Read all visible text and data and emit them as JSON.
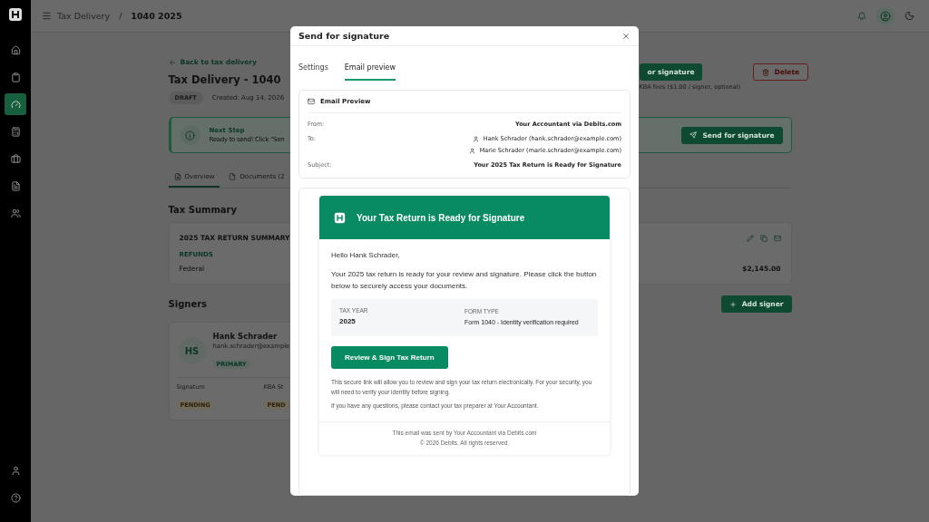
{
  "sidebar": {
    "nav": [
      {
        "selected": false
      },
      {
        "selected": false
      },
      {
        "selected": true
      },
      {
        "selected": false
      },
      {
        "selected": false
      },
      {
        "selected": false
      },
      {
        "selected": false
      }
    ]
  },
  "topbar": {
    "separator": "/",
    "breadcrumb": [
      {
        "label": "Tax Delivery",
        "current": false
      },
      {
        "label": "1040 2025",
        "current": true
      }
    ]
  },
  "page": {
    "back_link": "Back to tax delivery",
    "title": "Tax Delivery - 1040",
    "status": "DRAFT",
    "created": "Created: Aug 14, 2026",
    "actions": {
      "send_button": "or signature",
      "delete_button": "Delete",
      "note": "KBA fees ($1.00 / signer, optional)"
    },
    "next_step": {
      "title": "Next Step",
      "text": "Ready to send! Click \"Sen",
      "button": "Send for signature"
    },
    "tabs": [
      {
        "label": "Overview",
        "selected": true
      },
      {
        "label": "Documents (2",
        "selected": false
      }
    ],
    "tax_summary": {
      "heading": "Tax Summary",
      "card_title": "2025 TAX RETURN SUMMARY",
      "section": "REFUNDS",
      "rows": [
        {
          "label": "Federal",
          "amount": "$2,145.00"
        }
      ]
    },
    "signers": {
      "heading": "Signers",
      "add_button": "Add signer",
      "list": [
        {
          "initials": "HS",
          "name": "Hank Schrader",
          "email": "hank.schrader@example",
          "role": "PRIMARY",
          "signature_label": "Signature",
          "signature_status": "PENDING",
          "kba_label": "KBA St",
          "kba_status": "PEND"
        }
      ]
    }
  },
  "modal": {
    "title": "Send for signature",
    "tabs": [
      {
        "label": "Settings",
        "selected": false
      },
      {
        "label": "Email preview",
        "selected": true
      }
    ],
    "preview": {
      "heading": "Email Preview",
      "fields": [
        {
          "label": "From:",
          "kind": "text",
          "values": [
            "Your Accountant via Debits.com"
          ]
        },
        {
          "label": "To:",
          "kind": "recipients",
          "values": [
            "Hank Schrader (hank.schrader@example.com)",
            "Marie Schrader (marie.schrader@example.com)"
          ]
        },
        {
          "label": "Subject:",
          "kind": "text",
          "values": [
            "Your 2025 Tax Return is Ready for Signature"
          ]
        }
      ]
    },
    "email": {
      "header": "Your Tax Return is Ready for Signature",
      "greeting": "Hello Hank Schrader,",
      "intro": "Your 2025 tax return is ready for your review and signature. Please click the button below to securely access your documents.",
      "details": [
        {
          "label": "TAX YEAR",
          "value": "2025",
          "kind": "strong"
        },
        {
          "label": "FORM TYPE",
          "value": "Form 1040 - Identity verification required",
          "kind": "plain"
        }
      ],
      "button": "Review & Sign Tax Return",
      "notes": [
        "This secure link will allow you to review and sign your tax return electronically. For your security, you will need to verify your identity before signing.",
        "If you have any questions, please contact your tax preparer at Your Accountant."
      ],
      "footer": [
        "This email was sent by Your Accountant via Debits.com",
        "© 2026 Debits. All rights reserved."
      ]
    }
  }
}
